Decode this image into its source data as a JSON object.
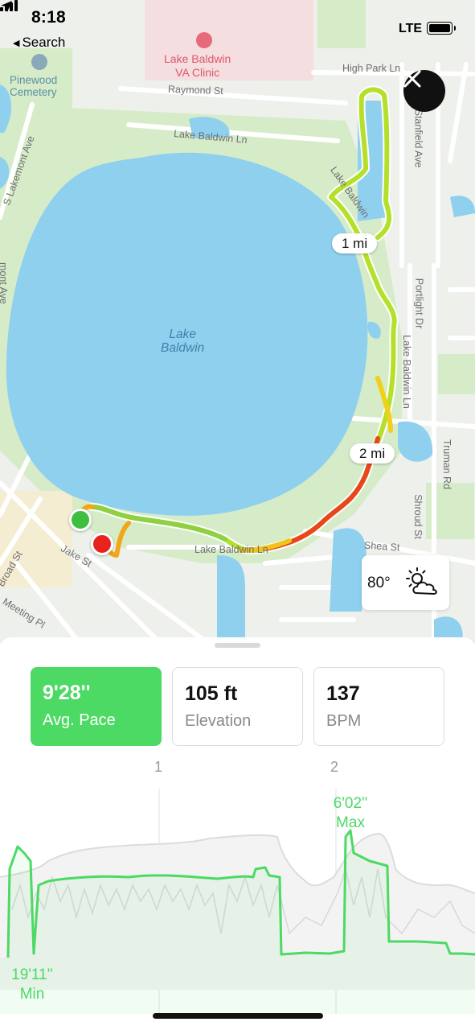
{
  "status_bar": {
    "time": "8:18",
    "back_label": "Search",
    "network": "LTE"
  },
  "map": {
    "poi": {
      "clinic": "Lake Baldwin\nVA Clinic",
      "cemetery": "Pinewood\nCemetery"
    },
    "lake": "Lake\nBaldwin",
    "streets": {
      "high_park": "High Park Ln",
      "raymond": "Raymond St",
      "lake_baldwin_top": "Lake Baldwin Ln",
      "lakemont": "S Lakemont Ave",
      "stanfield": "Stanfield Ave",
      "portlight": "Portlight Dr",
      "lake_baldwin_right": "Lake Baldwin Ln",
      "truman": "Truman Rd",
      "shroud": "Shroud St",
      "shea": "Shea St",
      "jake": "Jake St",
      "broad": "Broad St",
      "meeting": "Meeting Pl",
      "lake_baldwin_bottom": "Lake Baldwin Ln",
      "lake_baldwin_diag": "Lake Baldwin",
      "mont_ave": "mont Ave"
    },
    "mile_markers": [
      "1 mi",
      "2 mi"
    ],
    "weather": {
      "temperature": "80°",
      "icon": "partly-cloudy-icon"
    },
    "colors": {
      "route_start": "#3fbe3f",
      "route_end": "#e8231e",
      "water": "#8fd0ef",
      "park": "#cfe8c4"
    }
  },
  "metrics": {
    "pace": {
      "value": "9'28''",
      "label": "Avg. Pace"
    },
    "elevation": {
      "value": "105 ft",
      "label": "Elevation"
    },
    "bpm": {
      "value": "137",
      "label": "BPM"
    },
    "active_color": "#4cd964"
  },
  "chart": {
    "mile_labels": [
      "1",
      "2"
    ],
    "max": {
      "value": "6'02''",
      "label": "Max"
    },
    "min": {
      "value": "19'11''",
      "label": "Min"
    }
  }
}
